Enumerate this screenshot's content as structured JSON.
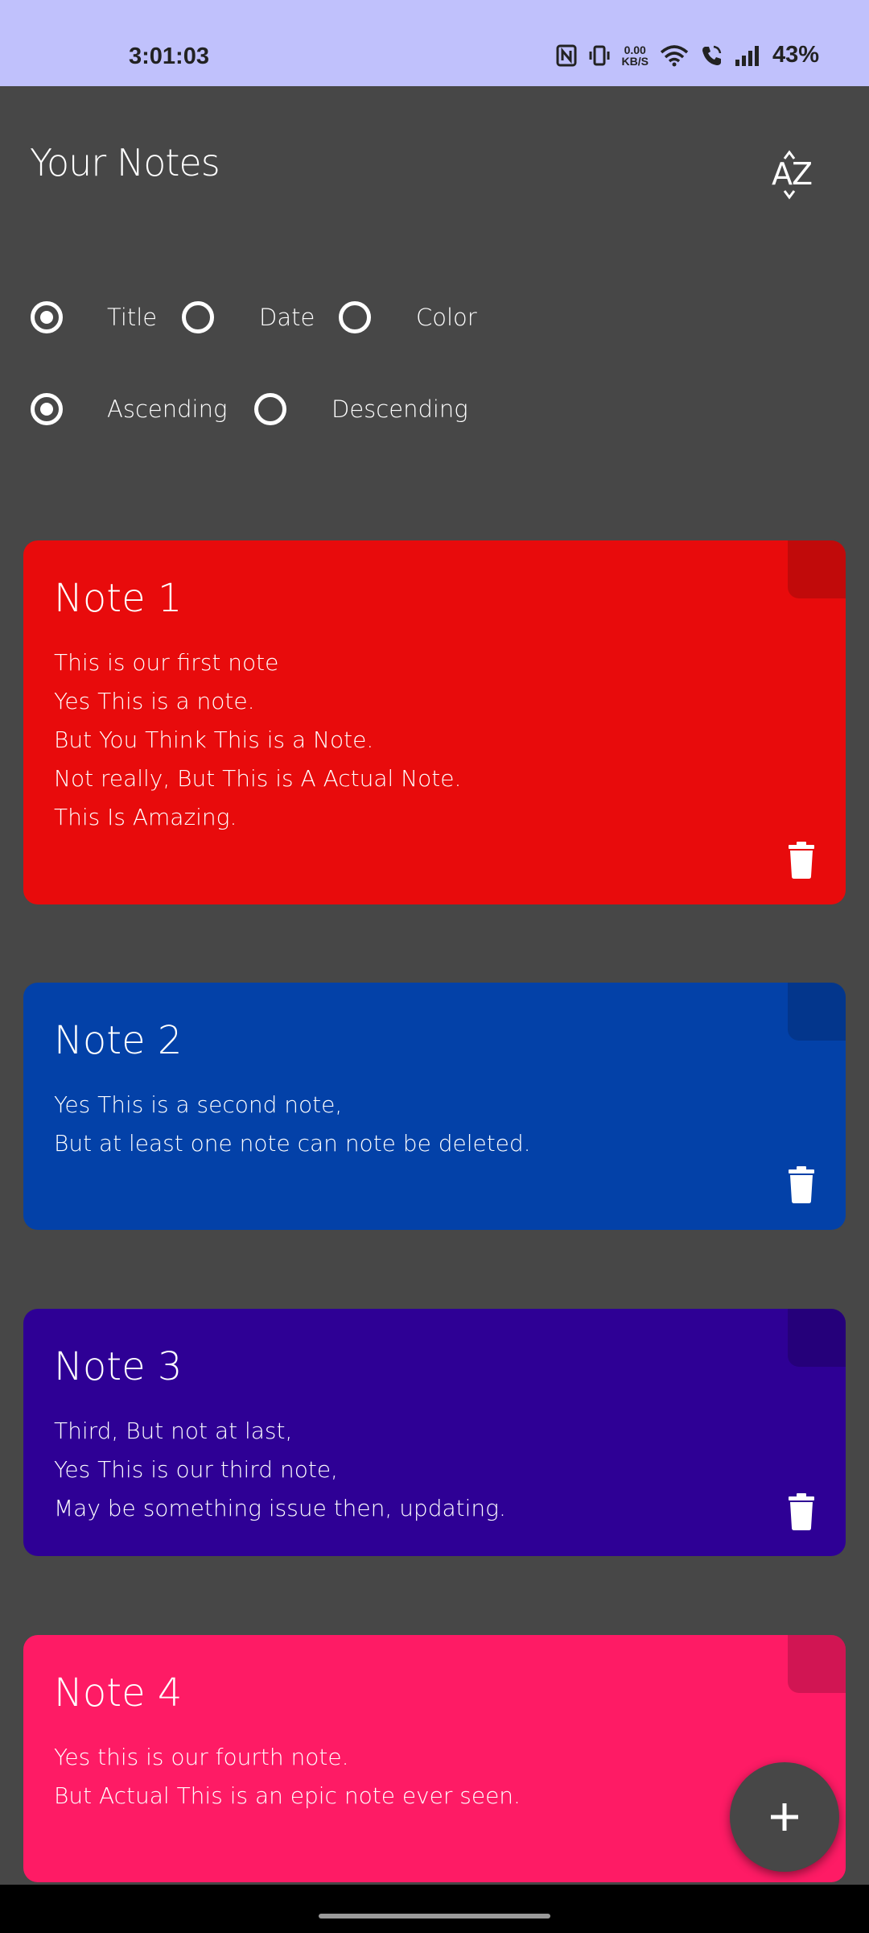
{
  "status_bar": {
    "time": "3:01:03",
    "net_speed_value": "0.00",
    "net_speed_unit": "KB/S",
    "battery": "43%",
    "icons": [
      "nfc-icon",
      "vibrate-icon",
      "wifi-icon",
      "wifi-call-icon",
      "signal-icon"
    ]
  },
  "header": {
    "title": "Your Notes",
    "sort_icon": "sort-az-icon"
  },
  "sort_by": {
    "options": [
      {
        "label": "Title",
        "selected": true
      },
      {
        "label": "Date",
        "selected": false
      },
      {
        "label": "Color",
        "selected": false
      }
    ]
  },
  "order": {
    "options": [
      {
        "label": "Ascending",
        "selected": true
      },
      {
        "label": "Descending",
        "selected": false
      }
    ]
  },
  "notes": [
    {
      "title": "Note 1",
      "color": "#e80b0c",
      "fold_color": "#c10a0a",
      "lines": [
        "This is our first note",
        "Yes This is a note.",
        "But You Think This is a Note.",
        "Not really, But This is A Actual Note.",
        "This Is Amazing."
      ]
    },
    {
      "title": "Note 2",
      "color": "#0341a8",
      "fold_color": "#03368c",
      "lines": [
        "Yes This is a second note,",
        "But at least one note can note be deleted."
      ]
    },
    {
      "title": "Note 3",
      "color": "#2e0095",
      "fold_color": "#25007a",
      "lines": [
        "Third, But not at last,",
        "Yes This is our third note,",
        "May be something issue then, updating."
      ]
    },
    {
      "title": "Note 4",
      "color": "#fe1b65",
      "fold_color": "#d11553",
      "lines": [
        "Yes this is our fourth note.",
        "But Actual This is an epic note ever seen."
      ]
    }
  ],
  "fab": {
    "icon": "plus-icon"
  },
  "colors": {
    "background": "#474747",
    "status_bar": "#c0c1fc"
  }
}
